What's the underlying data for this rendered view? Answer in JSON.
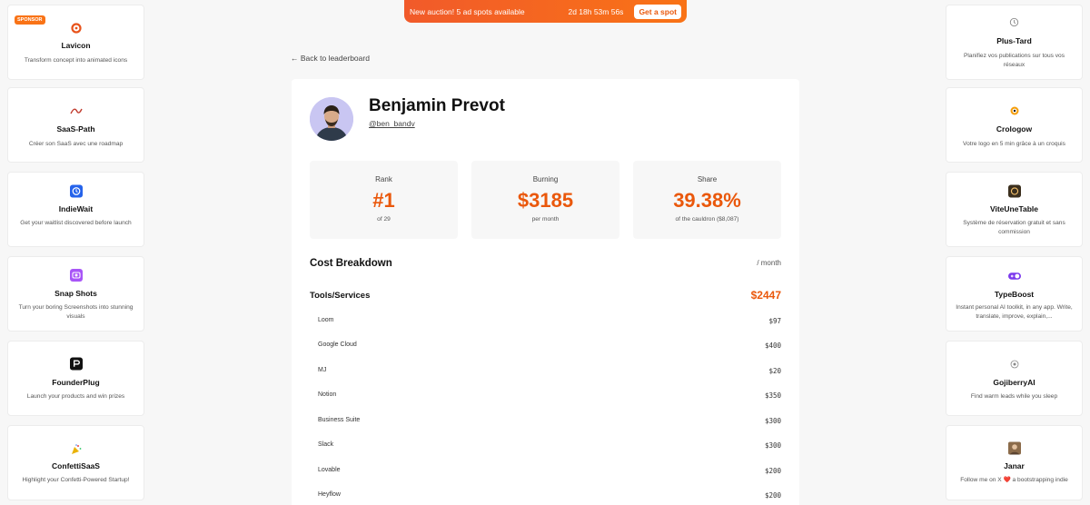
{
  "banner": {
    "message": "New auction!  5 ad spots available",
    "timer": "2d 18h 53m 56s",
    "cta": "Get a spot"
  },
  "left_sponsors": [
    {
      "badge": "SPONSOR",
      "name": "Lavicon",
      "desc": "Transform concept into animated icons",
      "icon": "lavicon-logo-icon",
      "color": "#e8531b"
    },
    {
      "name": "SaaS-Path",
      "desc": "Créer son SaaS avec une roadmap",
      "icon": "saaspath-logo-icon",
      "color": "#c0392b"
    },
    {
      "name": "IndieWait",
      "desc": "Get your waitlist discovered before launch",
      "icon": "indiewait-logo-icon",
      "color": "#2563eb"
    },
    {
      "name": "Snap Shots",
      "desc": "Turn your boring Screenshots into stunning visuals",
      "icon": "snapshots-logo-icon",
      "color": "#a855f7"
    },
    {
      "name": "FounderPlug",
      "desc": "Launch your products and win prizes",
      "icon": "founderplug-logo-icon",
      "color": "#111111"
    },
    {
      "name": "ConfettiSaaS",
      "desc": "Highlight your Confetti-Powered Startup!",
      "icon": "confetti-logo-icon",
      "color": "#eab308"
    }
  ],
  "right_sponsors": [
    {
      "name": "Plus-Tard",
      "desc": "Planifiez vos publications sur tous vos réseaux",
      "icon": "clock-icon",
      "color": "#888888"
    },
    {
      "name": "Crologow",
      "desc": "Votre logo en 5 min grâce à un croquis",
      "icon": "crologow-logo-icon",
      "color": "#f59e0b"
    },
    {
      "name": "ViteUneTable",
      "desc": "Système de réservation gratuit et sans commission",
      "icon": "viteunetable-logo-icon",
      "color": "#3b2f1e"
    },
    {
      "name": "TypeBoost",
      "desc": "Instant personal AI toolkit, in any app. Write, translate, improve, explain,...",
      "icon": "typeboost-logo-icon",
      "color": "#7c3aed"
    },
    {
      "name": "GojiberryAI",
      "desc": "Find warm leads while you sleep",
      "icon": "gojiberry-logo-icon",
      "color": "#888888"
    },
    {
      "name": "Janar",
      "desc": "Follow me on X ❤️ a bootstrapping indie",
      "icon": "janar-avatar-icon",
      "color": "#8b6b4a"
    }
  ],
  "back_link": "← Back to leaderboard",
  "profile": {
    "name": "Benjamin Prevot",
    "handle": "@ben_bandv"
  },
  "stats": [
    {
      "label": "Rank",
      "value": "#1",
      "sub": "of 29"
    },
    {
      "label": "Burning",
      "value": "$3185",
      "sub": "per month"
    },
    {
      "label": "Share",
      "value": "39.38%",
      "sub": "of the cauldron ($8,087)"
    }
  ],
  "cost": {
    "title": "Cost Breakdown",
    "period": "/ month",
    "category": "Tools/Services",
    "category_total": "$2447",
    "items": [
      {
        "name": "Loom",
        "price": "$97"
      },
      {
        "name": "Google Cloud",
        "price": "$400"
      },
      {
        "name": "MJ",
        "price": "$20"
      },
      {
        "name": "Notion",
        "price": "$350"
      },
      {
        "name": "Business Suite",
        "price": "$300"
      },
      {
        "name": "Slack",
        "price": "$300"
      },
      {
        "name": "Lovable",
        "price": "$200"
      },
      {
        "name": "Heyflow",
        "price": "$200"
      }
    ]
  },
  "colors": {
    "accent": "#ea580c",
    "banner": "#f15a2a"
  }
}
